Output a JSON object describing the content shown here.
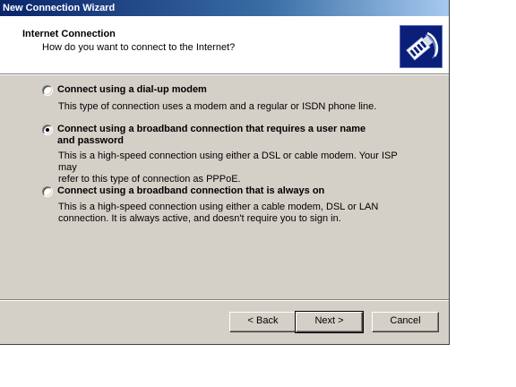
{
  "window": {
    "title": "New Connection Wizard"
  },
  "header": {
    "title": "Internet Connection",
    "subtitle": "How do you want to connect to the Internet?",
    "icon": "network-cable-icon"
  },
  "options": [
    {
      "label": "Connect using a dial-up modem",
      "desc": "This type of connection uses a modem and a regular or ISDN phone line.",
      "selected": false
    },
    {
      "label_line1": "Connect using a broadband connection that requires a user name",
      "label_line2": "and password",
      "desc_line1": "This is a high-speed connection using either a DSL or cable modem. Your ISP may",
      "desc_line2": "refer to this type of connection as PPPoE.",
      "selected": true
    },
    {
      "label": "Connect using a broadband connection that is always on",
      "desc_line1": "This is a high-speed connection using either a cable modem, DSL or LAN",
      "desc_line2": "connection. It is always active, and doesn't require you to sign in.",
      "selected": false
    }
  ],
  "buttons": {
    "back": "< Back",
    "next": "Next >",
    "cancel": "Cancel"
  }
}
